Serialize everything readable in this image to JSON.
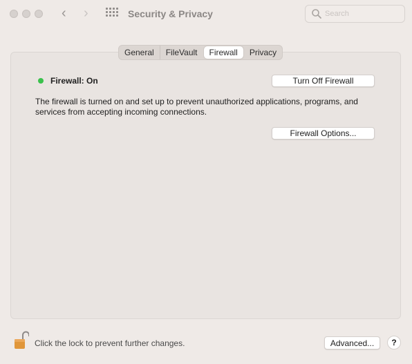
{
  "window": {
    "title": "Security & Privacy",
    "nav_back": "‹",
    "nav_forward": "›"
  },
  "search": {
    "placeholder": "Search"
  },
  "tabs": [
    {
      "label": "General",
      "active": false
    },
    {
      "label": "FileVault",
      "active": false
    },
    {
      "label": "Firewall",
      "active": true
    },
    {
      "label": "Privacy",
      "active": false
    }
  ],
  "firewall": {
    "status": "Firewall: On",
    "status_color": "#3ac14c",
    "toggle_button": "Turn Off Firewall",
    "description": "The firewall is turned on and set up to prevent unauthorized applications, programs, and services from accepting incoming connections.",
    "options_button": "Firewall Options..."
  },
  "footer": {
    "lock_text": "Click the lock to prevent further changes.",
    "advanced_button": "Advanced...",
    "help_button": "?"
  },
  "colors": {
    "lock": "#e0963a"
  }
}
